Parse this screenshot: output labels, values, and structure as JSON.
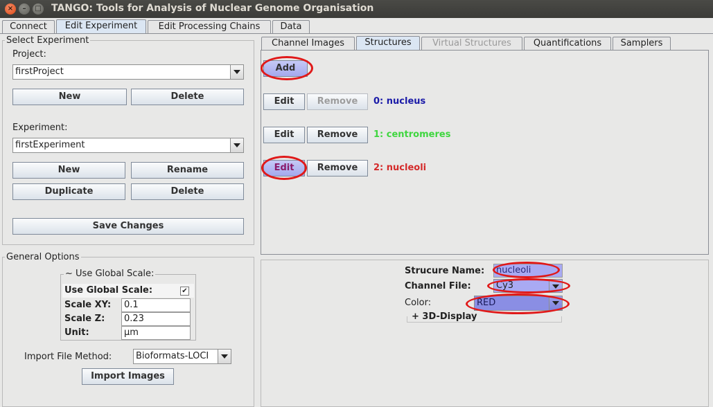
{
  "window": {
    "title": "TANGO: Tools for Analysis of Nuclear Genome Organisation",
    "close_glyph": "×",
    "min_glyph": "–",
    "max_glyph": "□"
  },
  "top_tabs": [
    {
      "label": "Connect"
    },
    {
      "label": "Edit Experiment"
    },
    {
      "label": "Edit Processing Chains"
    },
    {
      "label": "Data"
    }
  ],
  "select_experiment": {
    "title": "Select Experiment",
    "project_label": "Project:",
    "project_value": "firstProject",
    "new_label": "New",
    "delete_label": "Delete",
    "experiment_label": "Experiment:",
    "experiment_value": "firstExperiment",
    "exp_new_label": "New",
    "rename_label": "Rename",
    "duplicate_label": "Duplicate",
    "exp_delete_label": "Delete",
    "save_label": "Save Changes"
  },
  "general_options": {
    "title": "General Options",
    "group_title": "~ Use Global Scale:",
    "use_global_scale_label": "Use Global Scale:",
    "use_global_scale_checked": true,
    "check_glyph": "✔",
    "scale_xy_label": "Scale XY:",
    "scale_xy_value": "0.1",
    "scale_z_label": "Scale Z:",
    "scale_z_value": "0.23",
    "unit_label": "Unit:",
    "unit_value": "µm",
    "import_method_label": "Import File Method:",
    "import_method_value": "Bioformats-LOCI",
    "import_images_label": "Import Images"
  },
  "sub_tabs": [
    {
      "label": "Channel Images",
      "state": "normal"
    },
    {
      "label": "Structures",
      "state": "active"
    },
    {
      "label": "Virtual Structures",
      "state": "disabled"
    },
    {
      "label": "Quantifications",
      "state": "normal"
    },
    {
      "label": "Samplers",
      "state": "normal"
    }
  ],
  "structures": {
    "add_label": "Add",
    "edit_label": "Edit",
    "remove_label": "Remove",
    "items": [
      {
        "label": "0: nucleus",
        "color": "#1a1aa8"
      },
      {
        "label": "1: centromeres",
        "color": "#3fd63f"
      },
      {
        "label": "2: nucleoli",
        "color": "#d42a2a"
      }
    ]
  },
  "structure_editor": {
    "name_label": "Strucure Name:",
    "name_value": "nucleoli",
    "channel_label": "Channel File:",
    "channel_value": "Cy3",
    "color_label": "Color:",
    "color_value": "RED",
    "display_label": "+ 3D-Display"
  },
  "colors": {
    "highlight": "#e01919",
    "selected_field": "#a9aaf3",
    "color_combo": "#8a8ee4"
  }
}
